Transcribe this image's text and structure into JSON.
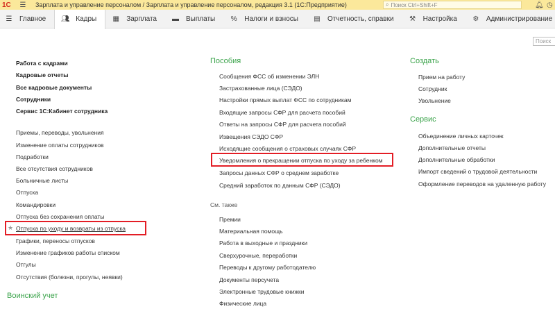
{
  "titlebar": {
    "title": "Зарплата и управление персоналом / Зарплата и управление персоналом, редакция 3.1  (1С:Предприятие)",
    "search_placeholder": "Поиск Ctrl+Shift+F",
    "logo": "1С"
  },
  "sections": [
    {
      "label": "Главное",
      "icon": "menu-icon"
    },
    {
      "label": "Кадры",
      "icon": "people-icon"
    },
    {
      "label": "Зарплата",
      "icon": "calculator-icon"
    },
    {
      "label": "Выплаты",
      "icon": "wallet-icon"
    },
    {
      "label": "Налоги и взносы",
      "icon": "percent-icon"
    },
    {
      "label": "Отчетность, справки",
      "icon": "report-icon"
    },
    {
      "label": "Настройка",
      "icon": "wrench-icon"
    },
    {
      "label": "Администрирование",
      "icon": "gear-icon"
    }
  ],
  "panel_search": "Поиск",
  "left": {
    "main_links": [
      "Работа с кадрами",
      "Кадровые отчеты",
      "Все кадровые документы",
      "Сотрудники",
      "Сервис 1С:Кабинет сотрудника"
    ],
    "links": [
      "Приемы, переводы, увольнения",
      "Изменение оплаты сотрудников",
      "Подработки",
      "Все отсутствия сотрудников",
      "Больничные листы",
      "Отпуска",
      "Командировки",
      "Отпуска без сохранения оплаты",
      "Отпуска по уходу и возвраты из отпуска",
      "Графики, переносы отпусков",
      "Изменение графиков работы списком",
      "Отгулы",
      "Отсутствия (болезни, прогулы, неявки)"
    ],
    "military_header": "Воинский учет"
  },
  "middle": {
    "benefits_header": "Пособия",
    "benefits": [
      "Сообщения ФСС об изменении ЭЛН",
      "Застрахованные лица (СЭДО)",
      "Настройки прямых выплат ФСС по сотрудникам",
      "Входящие запросы СФР для расчета пособий",
      "Ответы на запросы СФР для расчета пособий",
      "Извещения СЭДО СФР",
      "Исходящие сообщения о страховых случаях СФР",
      "Уведомления о прекращении отпуска по уходу за ребенком",
      "Запросы данных СФР о среднем заработке",
      "Средний заработок по данным СФР (СЭДО)"
    ],
    "see_also_header": "См. также",
    "see_also": [
      "Премии",
      "Материальная помощь",
      "Работа в выходные и праздники",
      "Сверхурочные, переработки",
      "Переводы к другому работодателю",
      "Документы персучета",
      "Электронные трудовые книжки",
      "Физические лица"
    ]
  },
  "right": {
    "create_header": "Создать",
    "create": [
      "Прием на работу",
      "Сотрудник",
      "Увольнение"
    ],
    "service_header": "Сервис",
    "service": [
      "Объединение личных карточек",
      "Дополнительные отчеты",
      "Дополнительные обработки",
      "Импорт сведений о трудовой деятельности",
      "Оформление переводов на удаленную работу"
    ]
  }
}
